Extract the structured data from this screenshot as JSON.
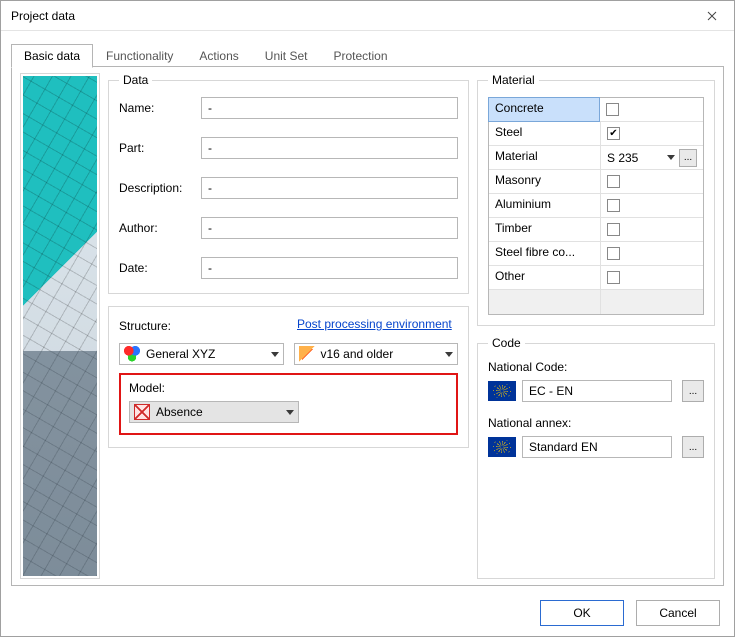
{
  "window": {
    "title": "Project data"
  },
  "tabs": [
    "Basic data",
    "Functionality",
    "Actions",
    "Unit Set",
    "Protection"
  ],
  "active_tab_index": 0,
  "data_group": {
    "legend": "Data",
    "name_label": "Name:",
    "name_value": "-",
    "part_label": "Part:",
    "part_value": "-",
    "description_label": "Description:",
    "description_value": "-",
    "author_label": "Author:",
    "author_value": "-",
    "date_label": "Date:",
    "date_value": "-"
  },
  "structure": {
    "label": "Structure:",
    "link_text": "Post processing environment",
    "structure_dd": "General XYZ",
    "postproc_dd": "v16 and older",
    "model_label": "Model:",
    "model_dd": "Absence"
  },
  "material": {
    "legend": "Material",
    "rows": [
      {
        "name": "Concrete",
        "checked": false,
        "selected": true
      },
      {
        "name": "Steel",
        "checked": true
      },
      {
        "name": "Material",
        "value": "S 235",
        "is_dropdown": true
      },
      {
        "name": "Masonry",
        "checked": false
      },
      {
        "name": "Aluminium",
        "checked": false
      },
      {
        "name": "Timber",
        "checked": false
      },
      {
        "name": "Steel fibre co...",
        "checked": false
      },
      {
        "name": "Other",
        "checked": false
      }
    ]
  },
  "code": {
    "legend": "Code",
    "national_code_label": "National Code:",
    "national_code_value": "EC - EN",
    "national_annex_label": "National annex:",
    "national_annex_value": "Standard EN"
  },
  "buttons": {
    "ok": "OK",
    "cancel": "Cancel",
    "ellipsis": "..."
  }
}
